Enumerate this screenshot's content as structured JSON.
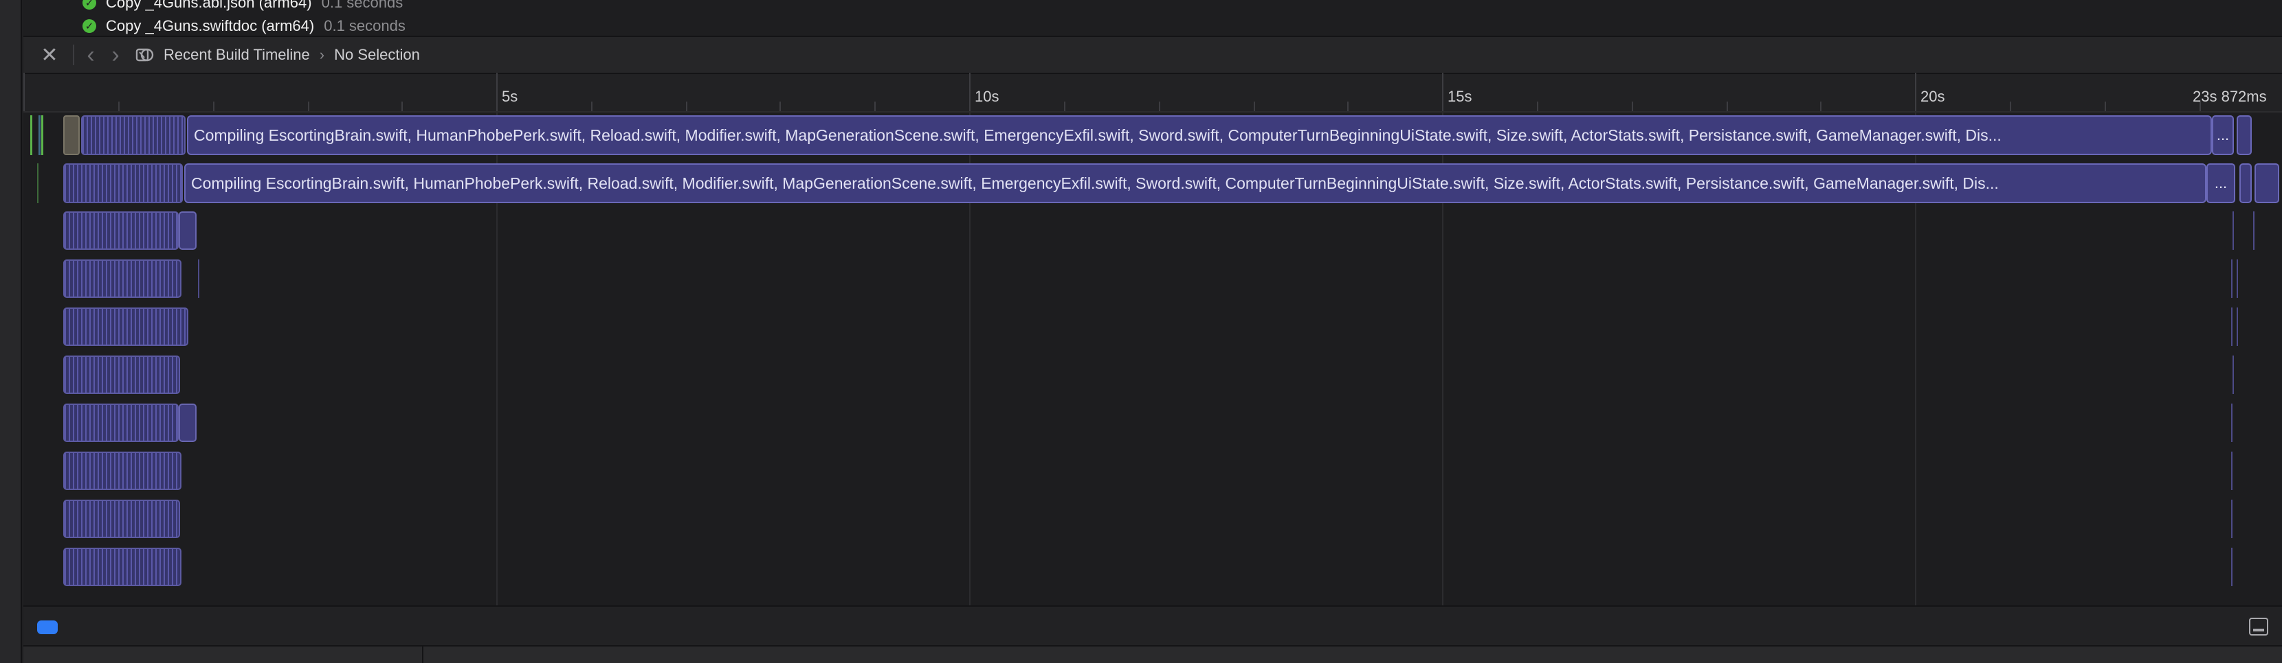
{
  "log": {
    "items": [
      {
        "name": "Copy _4Guns.abi.json (arm64)",
        "duration": "0.1 seconds"
      },
      {
        "name": "Copy _4Guns.swiftdoc (arm64)",
        "duration": "0.1 seconds"
      }
    ]
  },
  "toolbar": {
    "close_icon": "xmark-icon",
    "back_icon": "chevron-left-icon",
    "forward_icon": "chevron-right-icon",
    "timeline_icon": "build-timeline-icon",
    "breadcrumb": [
      "Recent Build Timeline",
      "No Selection"
    ]
  },
  "ruler": {
    "ticks": [
      "5s",
      "10s",
      "15s",
      "20s"
    ],
    "end_label": "23s 872ms"
  },
  "timeline": {
    "compile_label": "Compiling EscortingBrain.swift, HumanPhobePerk.swift, Reload.swift, Modifier.swift, MapGenerationScene.swift, EmergencyExfil.swift, Sword.swift, ComputerTurnBeginningUiState.swift, Size.swift, ActorStats.swift, Persistance.swift, GameManager.swift, Dis...",
    "ellipsis": "..."
  },
  "status": {
    "accent": "#2f7cf6",
    "success": "#4cbb3c",
    "bar_fill": "#3e3c7c"
  }
}
